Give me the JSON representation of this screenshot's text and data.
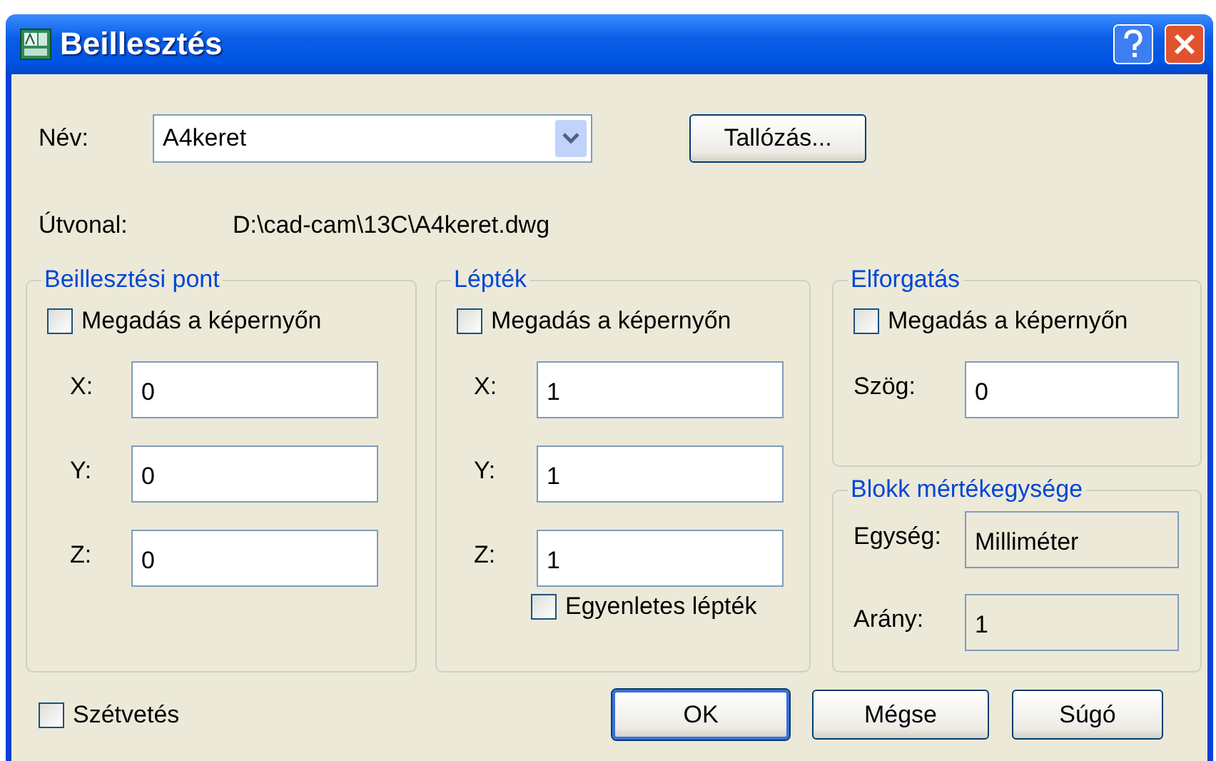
{
  "window": {
    "title": "Beillesztés"
  },
  "name_row": {
    "label": "Név:",
    "value": "A4keret",
    "browse_button": "Tallózás..."
  },
  "path_row": {
    "label": "Útvonal:",
    "value": "D:\\cad-cam\\13C\\A4keret.dwg"
  },
  "insertion_point": {
    "title": "Beillesztési pont",
    "checkbox": {
      "label": "Megadás a képernyőn",
      "checked": false
    },
    "fields": [
      {
        "label": "X:",
        "value": "0",
        "readonly": false
      },
      {
        "label": "Y:",
        "value": "0",
        "readonly": false
      },
      {
        "label": "Z:",
        "value": "0",
        "readonly": false
      }
    ]
  },
  "scale": {
    "title": "Lépték",
    "checkbox": {
      "label": "Megadás a képernyőn",
      "checked": false
    },
    "fields": [
      {
        "label": "X:",
        "value": "1",
        "readonly": false
      },
      {
        "label": "Y:",
        "value": "1",
        "readonly": false
      },
      {
        "label": "Z:",
        "value": "1",
        "readonly": false
      }
    ],
    "uniform_checkbox": {
      "label": "Egyenletes lépték",
      "checked": false
    }
  },
  "rotation": {
    "title": "Elforgatás",
    "checkbox": {
      "label": "Megadás a képernyőn",
      "checked": false
    },
    "fields": [
      {
        "label": "Szög:",
        "value": "0",
        "readonly": false
      }
    ]
  },
  "block_units": {
    "title": "Blokk mértékegysége",
    "fields": [
      {
        "label": "Egység:",
        "value": "Milliméter",
        "readonly": true
      },
      {
        "label": "Arány:",
        "value": "1",
        "readonly": true
      }
    ]
  },
  "explode_checkbox": {
    "label": "Szétvetés",
    "checked": false
  },
  "buttons": [
    {
      "label": "OK",
      "default": true
    },
    {
      "label": "Mégse",
      "default": false
    },
    {
      "label": "Súgó",
      "default": false
    }
  ]
}
